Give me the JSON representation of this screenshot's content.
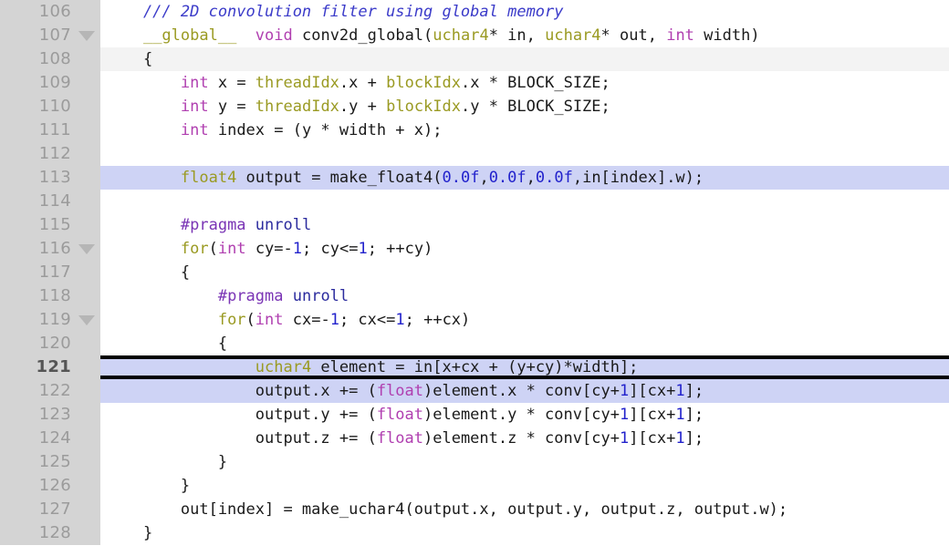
{
  "editor": {
    "title": "source-code-editor",
    "language": "cuda-c",
    "first_line_number": 106,
    "last_line_number": 128,
    "active_line_number": 121,
    "colors": {
      "gutter_bg": "#d4d4d4",
      "code_bg": "#ffffff",
      "lineno_fg": "#9b9b9b",
      "active_lineno_fg": "#555555",
      "highlight_bg": "#ced3f5",
      "subtle_bg": "#f3f3f3",
      "marker_rule": "#000000",
      "comment": "#3b3bc9",
      "keyword": "#b03fb0",
      "type": "#9a9a22",
      "number": "#2222cc",
      "preprocessor": "#7a34b5",
      "preprocessor_arg": "#2b2b9e",
      "plain_text": "#1a1a1a",
      "fold_triangle": "#b6b6b6"
    }
  },
  "lines": [
    {
      "number": "106",
      "fold": false,
      "highlight": false,
      "subtle": false,
      "rule_top": false,
      "rule_bottom": false,
      "active": false,
      "text": "/// 2D convolution filter using global memory",
      "tokens": [
        {
          "cls": "t-cmt",
          "text": "    /// 2D convolution filter using global memory"
        }
      ]
    },
    {
      "number": "107",
      "fold": true,
      "highlight": false,
      "subtle": false,
      "rule_top": false,
      "rule_bottom": false,
      "active": false,
      "text": "__global__ void conv2d_global(uchar4* in, uchar4* out, int width)",
      "tokens": [
        {
          "cls": "t-plain",
          "text": "    "
        },
        {
          "cls": "t-type",
          "text": "__global__"
        },
        {
          "cls": "t-plain",
          "text": "  "
        },
        {
          "cls": "t-kw",
          "text": "void"
        },
        {
          "cls": "t-plain",
          "text": " conv2d_global("
        },
        {
          "cls": "t-type",
          "text": "uchar4"
        },
        {
          "cls": "t-plain",
          "text": "* in, "
        },
        {
          "cls": "t-type",
          "text": "uchar4"
        },
        {
          "cls": "t-plain",
          "text": "* out, "
        },
        {
          "cls": "t-kw",
          "text": "int"
        },
        {
          "cls": "t-plain",
          "text": " width)"
        }
      ]
    },
    {
      "number": "108",
      "fold": false,
      "highlight": false,
      "subtle": true,
      "rule_top": false,
      "rule_bottom": false,
      "active": false,
      "text": "{",
      "tokens": [
        {
          "cls": "t-plain",
          "text": "    {"
        }
      ]
    },
    {
      "number": "109",
      "fold": false,
      "highlight": false,
      "subtle": false,
      "rule_top": false,
      "rule_bottom": false,
      "active": false,
      "text": "    int x = threadIdx.x + blockIdx.x * BLOCK_SIZE;",
      "tokens": [
        {
          "cls": "t-plain",
          "text": "        "
        },
        {
          "cls": "t-kw",
          "text": "int"
        },
        {
          "cls": "t-plain",
          "text": " x = "
        },
        {
          "cls": "t-type",
          "text": "threadIdx"
        },
        {
          "cls": "t-plain",
          "text": ".x + "
        },
        {
          "cls": "t-type",
          "text": "blockIdx"
        },
        {
          "cls": "t-plain",
          "text": ".x * BLOCK_SIZE;"
        }
      ]
    },
    {
      "number": "110",
      "fold": false,
      "highlight": false,
      "subtle": false,
      "rule_top": false,
      "rule_bottom": false,
      "active": false,
      "text": "    int y = threadIdx.y + blockIdx.y * BLOCK_SIZE;",
      "tokens": [
        {
          "cls": "t-plain",
          "text": "        "
        },
        {
          "cls": "t-kw",
          "text": "int"
        },
        {
          "cls": "t-plain",
          "text": " y = "
        },
        {
          "cls": "t-type",
          "text": "threadIdx"
        },
        {
          "cls": "t-plain",
          "text": ".y + "
        },
        {
          "cls": "t-type",
          "text": "blockIdx"
        },
        {
          "cls": "t-plain",
          "text": ".y * BLOCK_SIZE;"
        }
      ]
    },
    {
      "number": "111",
      "fold": false,
      "highlight": false,
      "subtle": false,
      "rule_top": false,
      "rule_bottom": false,
      "active": false,
      "text": "    int index = (y * width + x);",
      "tokens": [
        {
          "cls": "t-plain",
          "text": "        "
        },
        {
          "cls": "t-kw",
          "text": "int"
        },
        {
          "cls": "t-plain",
          "text": " index = (y * width + x);"
        }
      ]
    },
    {
      "number": "112",
      "fold": false,
      "highlight": false,
      "subtle": false,
      "rule_top": false,
      "rule_bottom": false,
      "active": false,
      "text": "",
      "tokens": []
    },
    {
      "number": "113",
      "fold": false,
      "highlight": true,
      "subtle": false,
      "rule_top": false,
      "rule_bottom": false,
      "active": false,
      "text": "    float4 output = make_float4(0.0f,0.0f,0.0f,in[index].w);",
      "tokens": [
        {
          "cls": "t-plain",
          "text": "        "
        },
        {
          "cls": "t-type",
          "text": "float4"
        },
        {
          "cls": "t-plain",
          "text": " output = make_float4("
        },
        {
          "cls": "t-num",
          "text": "0.0f"
        },
        {
          "cls": "t-plain",
          "text": ","
        },
        {
          "cls": "t-num",
          "text": "0.0f"
        },
        {
          "cls": "t-plain",
          "text": ","
        },
        {
          "cls": "t-num",
          "text": "0.0f"
        },
        {
          "cls": "t-plain",
          "text": ",in[index].w);"
        }
      ]
    },
    {
      "number": "114",
      "fold": false,
      "highlight": false,
      "subtle": false,
      "rule_top": false,
      "rule_bottom": false,
      "active": false,
      "text": "",
      "tokens": []
    },
    {
      "number": "115",
      "fold": false,
      "highlight": false,
      "subtle": false,
      "rule_top": false,
      "rule_bottom": false,
      "active": false,
      "text": "    #pragma unroll",
      "tokens": [
        {
          "cls": "t-plain",
          "text": "        "
        },
        {
          "cls": "t-pre",
          "text": "#pragma"
        },
        {
          "cls": "t-plain",
          "text": " "
        },
        {
          "cls": "t-pre2",
          "text": "unroll"
        }
      ]
    },
    {
      "number": "116",
      "fold": true,
      "highlight": false,
      "subtle": false,
      "rule_top": false,
      "rule_bottom": false,
      "active": false,
      "text": "    for(int cy=-1; cy<=1; ++cy)",
      "tokens": [
        {
          "cls": "t-plain",
          "text": "        "
        },
        {
          "cls": "t-type",
          "text": "for"
        },
        {
          "cls": "t-plain",
          "text": "("
        },
        {
          "cls": "t-kw",
          "text": "int"
        },
        {
          "cls": "t-plain",
          "text": " cy=-"
        },
        {
          "cls": "t-num",
          "text": "1"
        },
        {
          "cls": "t-plain",
          "text": "; cy<="
        },
        {
          "cls": "t-num",
          "text": "1"
        },
        {
          "cls": "t-plain",
          "text": "; ++cy)"
        }
      ]
    },
    {
      "number": "117",
      "fold": false,
      "highlight": false,
      "subtle": false,
      "rule_top": false,
      "rule_bottom": false,
      "active": false,
      "text": "    {",
      "tokens": [
        {
          "cls": "t-plain",
          "text": "        {"
        }
      ]
    },
    {
      "number": "118",
      "fold": false,
      "highlight": false,
      "subtle": false,
      "rule_top": false,
      "rule_bottom": false,
      "active": false,
      "text": "        #pragma unroll",
      "tokens": [
        {
          "cls": "t-plain",
          "text": "            "
        },
        {
          "cls": "t-pre",
          "text": "#pragma"
        },
        {
          "cls": "t-plain",
          "text": " "
        },
        {
          "cls": "t-pre2",
          "text": "unroll"
        }
      ]
    },
    {
      "number": "119",
      "fold": true,
      "highlight": false,
      "subtle": false,
      "rule_top": false,
      "rule_bottom": false,
      "active": false,
      "text": "        for(int cx=-1; cx<=1; ++cx)",
      "tokens": [
        {
          "cls": "t-plain",
          "text": "            "
        },
        {
          "cls": "t-type",
          "text": "for"
        },
        {
          "cls": "t-plain",
          "text": "("
        },
        {
          "cls": "t-kw",
          "text": "int"
        },
        {
          "cls": "t-plain",
          "text": " cx=-"
        },
        {
          "cls": "t-num",
          "text": "1"
        },
        {
          "cls": "t-plain",
          "text": "; cx<="
        },
        {
          "cls": "t-num",
          "text": "1"
        },
        {
          "cls": "t-plain",
          "text": "; ++cx)"
        }
      ]
    },
    {
      "number": "120",
      "fold": false,
      "highlight": false,
      "subtle": false,
      "rule_top": false,
      "rule_bottom": false,
      "active": false,
      "text": "        {",
      "tokens": [
        {
          "cls": "t-plain",
          "text": "            {"
        }
      ]
    },
    {
      "number": "121",
      "fold": false,
      "highlight": true,
      "subtle": false,
      "rule_top": true,
      "rule_bottom": true,
      "active": true,
      "text": "            uchar4 element = in[x+cx + (y+cy)*width];",
      "tokens": [
        {
          "cls": "t-plain",
          "text": "                "
        },
        {
          "cls": "t-type",
          "text": "uchar4"
        },
        {
          "cls": "t-plain",
          "text": " element = in[x+cx + (y+cy)*width];"
        }
      ]
    },
    {
      "number": "122",
      "fold": false,
      "highlight": true,
      "subtle": false,
      "rule_top": false,
      "rule_bottom": false,
      "active": false,
      "text": "            output.x += (float)element.x * conv[cy+1][cx+1];",
      "tokens": [
        {
          "cls": "t-plain",
          "text": "                output.x += ("
        },
        {
          "cls": "t-kw",
          "text": "float"
        },
        {
          "cls": "t-plain",
          "text": ")element.x * conv[cy+"
        },
        {
          "cls": "t-num",
          "text": "1"
        },
        {
          "cls": "t-plain",
          "text": "][cx+"
        },
        {
          "cls": "t-num",
          "text": "1"
        },
        {
          "cls": "t-plain",
          "text": "];"
        }
      ]
    },
    {
      "number": "123",
      "fold": false,
      "highlight": false,
      "subtle": false,
      "rule_top": false,
      "rule_bottom": false,
      "active": false,
      "text": "            output.y += (float)element.y * conv[cy+1][cx+1];",
      "tokens": [
        {
          "cls": "t-plain",
          "text": "                output.y += ("
        },
        {
          "cls": "t-kw",
          "text": "float"
        },
        {
          "cls": "t-plain",
          "text": ")element.y * conv[cy+"
        },
        {
          "cls": "t-num",
          "text": "1"
        },
        {
          "cls": "t-plain",
          "text": "][cx+"
        },
        {
          "cls": "t-num",
          "text": "1"
        },
        {
          "cls": "t-plain",
          "text": "];"
        }
      ]
    },
    {
      "number": "124",
      "fold": false,
      "highlight": false,
      "subtle": false,
      "rule_top": false,
      "rule_bottom": false,
      "active": false,
      "text": "            output.z += (float)element.z * conv[cy+1][cx+1];",
      "tokens": [
        {
          "cls": "t-plain",
          "text": "                output.z += ("
        },
        {
          "cls": "t-kw",
          "text": "float"
        },
        {
          "cls": "t-plain",
          "text": ")element.z * conv[cy+"
        },
        {
          "cls": "t-num",
          "text": "1"
        },
        {
          "cls": "t-plain",
          "text": "][cx+"
        },
        {
          "cls": "t-num",
          "text": "1"
        },
        {
          "cls": "t-plain",
          "text": "];"
        }
      ]
    },
    {
      "number": "125",
      "fold": false,
      "highlight": false,
      "subtle": false,
      "rule_top": false,
      "rule_bottom": false,
      "active": false,
      "text": "        }",
      "tokens": [
        {
          "cls": "t-plain",
          "text": "            }"
        }
      ]
    },
    {
      "number": "126",
      "fold": false,
      "highlight": false,
      "subtle": false,
      "rule_top": false,
      "rule_bottom": false,
      "active": false,
      "text": "    }",
      "tokens": [
        {
          "cls": "t-plain",
          "text": "        }"
        }
      ]
    },
    {
      "number": "127",
      "fold": false,
      "highlight": false,
      "subtle": false,
      "rule_top": false,
      "rule_bottom": false,
      "active": false,
      "text": "    out[index] = make_uchar4(output.x, output.y, output.z, output.w);",
      "tokens": [
        {
          "cls": "t-plain",
          "text": "        out[index] = make_uchar4(output.x, output.y, output.z, output.w);"
        }
      ]
    },
    {
      "number": "128",
      "fold": false,
      "highlight": false,
      "subtle": false,
      "rule_top": false,
      "rule_bottom": false,
      "active": false,
      "text": "}",
      "tokens": [
        {
          "cls": "t-plain",
          "text": "    }"
        }
      ]
    }
  ]
}
